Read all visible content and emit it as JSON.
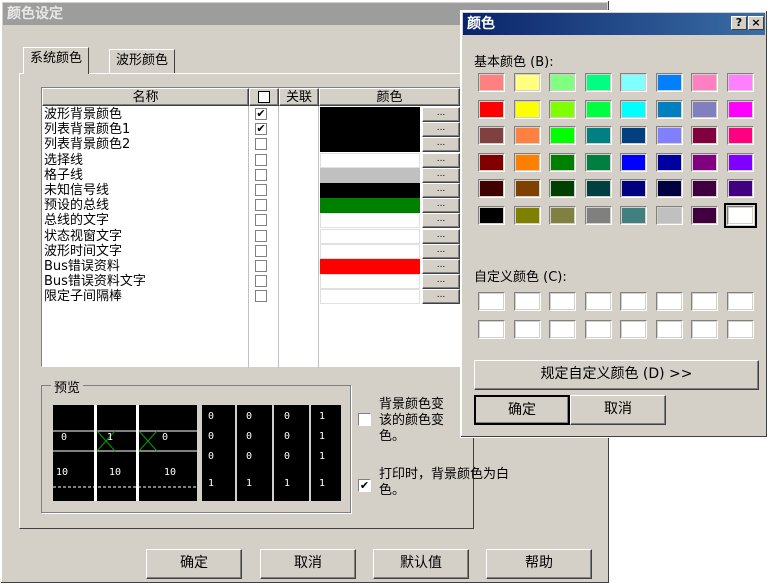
{
  "main_dialog": {
    "title": "颜色设定",
    "tabs": [
      "系统颜色",
      "波形颜色"
    ],
    "columns": {
      "name": "名称",
      "link": "关联",
      "color": "颜色"
    },
    "rows": [
      {
        "name": "波形背景颜色",
        "linked": "✔",
        "color": "#000000",
        "has_picker": true
      },
      {
        "name": "列表背景颜色1",
        "linked": "✔",
        "color": "#000000",
        "has_picker": true
      },
      {
        "name": "列表背景颜色2",
        "linked": "",
        "color": "#000000",
        "has_picker": true
      },
      {
        "name": "选择线",
        "linked": "",
        "color": "#ffffff",
        "has_picker": true
      },
      {
        "name": "格子线",
        "linked": "",
        "color": "#c0c0c0",
        "has_picker": true
      },
      {
        "name": "未知信号线",
        "linked": "",
        "color": "#000000",
        "has_picker": true
      },
      {
        "name": "预设的总线",
        "linked": "",
        "color": "#008000",
        "has_picker": true
      },
      {
        "name": "总线的文字",
        "linked": "",
        "color": "#ffffff",
        "has_picker": true
      },
      {
        "name": "状态视窗文字",
        "linked": "",
        "color": "#ffffff",
        "has_picker": true
      },
      {
        "name": "波形时间文字",
        "linked": "",
        "color": "#ffffff",
        "has_picker": true
      },
      {
        "name": "Bus错误资料",
        "linked": "",
        "color": "#ff0000",
        "has_picker": true
      },
      {
        "name": "Bus错误资料文字",
        "linked": "",
        "color": "#ffffff",
        "has_picker": true
      },
      {
        "name": "限定子间隔棒",
        "linked": "",
        "color": "#ffffff",
        "has_picker": true
      }
    ],
    "dots_label": "...",
    "preview": {
      "title": "预览",
      "wave_labels": [
        "0",
        "1",
        "0",
        "10",
        "10",
        "10"
      ],
      "list_cols": [
        [
          "0",
          "0",
          "0",
          "1"
        ],
        [
          "0",
          "0",
          "0",
          "1"
        ],
        [
          "0",
          "0",
          "0",
          "1"
        ],
        [
          "1",
          "1",
          "1",
          "1"
        ]
      ]
    },
    "option1": {
      "checked": "",
      "text_line1": "背景颜色变",
      "text_line2": "该的颜色变",
      "text_line3": "色。"
    },
    "option2": {
      "checked": "✔",
      "text_line1": "打印时，背景颜色为白",
      "text_line2": "色。"
    },
    "buttons": {
      "ok": "确定",
      "cancel": "取消",
      "default": "默认值",
      "help": "帮助"
    }
  },
  "color_dialog": {
    "title": "颜色",
    "help_btn": "?",
    "close_btn": "×",
    "basic_label": "基本颜色 (B):",
    "custom_label": "自定义颜色 (C):",
    "define_button": "规定自定义颜色 (D) >>",
    "ok": "确定",
    "cancel": "取消",
    "selected_index": 47,
    "basic_colors": [
      "#ff8080",
      "#ffff80",
      "#80ff80",
      "#00ff80",
      "#80ffff",
      "#0080ff",
      "#ff80c0",
      "#ff80ff",
      "#ff0000",
      "#ffff00",
      "#80ff00",
      "#00ff40",
      "#00ffff",
      "#0080c0",
      "#8080c0",
      "#ff00ff",
      "#804040",
      "#ff8040",
      "#00ff00",
      "#008080",
      "#004080",
      "#8080ff",
      "#800040",
      "#ff0080",
      "#800000",
      "#ff8000",
      "#008000",
      "#008040",
      "#0000ff",
      "#0000a0",
      "#800080",
      "#8000ff",
      "#400000",
      "#804000",
      "#004000",
      "#004040",
      "#000080",
      "#000040",
      "#400040",
      "#400080",
      "#000000",
      "#808000",
      "#808040",
      "#808080",
      "#408080",
      "#c0c0c0",
      "#400040",
      "#ffffff"
    ],
    "custom_colors": [
      "#ffffff",
      "#ffffff",
      "#ffffff",
      "#ffffff",
      "#ffffff",
      "#ffffff",
      "#ffffff",
      "#ffffff",
      "#ffffff",
      "#ffffff",
      "#ffffff",
      "#ffffff",
      "#ffffff",
      "#ffffff",
      "#ffffff",
      "#ffffff"
    ]
  }
}
